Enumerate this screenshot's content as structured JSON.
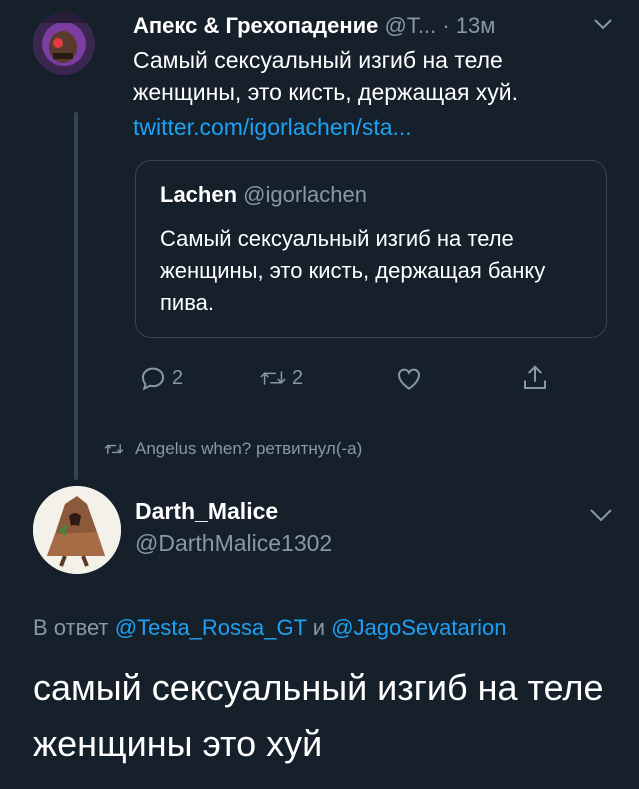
{
  "tweet1": {
    "author_name": "Апекс & Грехопадение",
    "author_handle": "@T...",
    "time": "· 13м",
    "text": "Самый сексуальный изгиб на теле женщины, это кисть, держащая хуй.",
    "link": "twitter.com/igorlachen/sta...",
    "quote": {
      "name": "Lachen",
      "handle": "@igorlachen",
      "text": "Самый сексуальный изгиб на теле женщины, это кисть, держащая банку пива."
    },
    "actions": {
      "reply_count": "2",
      "retweet_count": "2"
    },
    "retweet_notice": "Angelus when? ретвитнул(-а)"
  },
  "tweet2": {
    "author_name": "Darth_Malice",
    "author_handle": "@DarthMalice1302",
    "reply_prefix": "В ответ",
    "reply_mention1": "@Testa_Rossa_GT",
    "reply_and": "и",
    "reply_mention2": "@JagoSevatarion",
    "text": "самый сексуальный изгиб на теле женщины это хуй"
  },
  "colors": {
    "background": "#15202b",
    "secondary_text": "#8899a6",
    "link": "#1da1f2",
    "border": "#38444d"
  }
}
